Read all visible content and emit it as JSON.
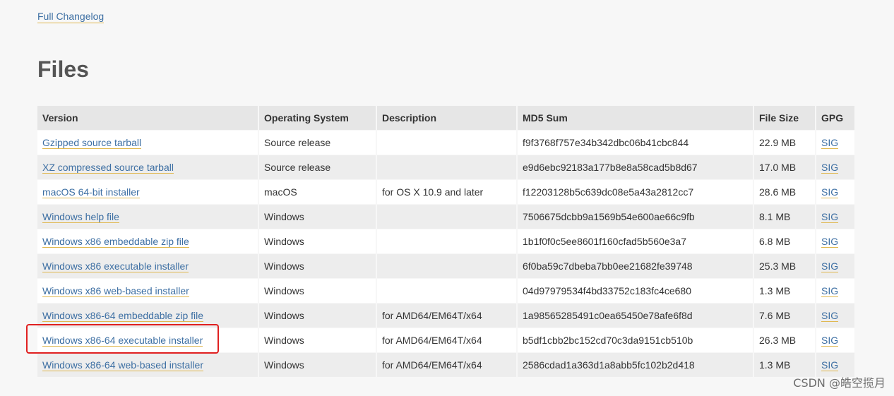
{
  "changelog_link": "Full Changelog",
  "section_title": "Files",
  "table": {
    "headers": {
      "version": "Version",
      "os": "Operating System",
      "description": "Description",
      "md5": "MD5 Sum",
      "size": "File Size",
      "gpg": "GPG"
    },
    "rows": [
      {
        "version": "Gzipped source tarball",
        "os": "Source release",
        "description": "",
        "md5": "f9f3768f757e34b342dbc06b41cbc844",
        "size": "22.9 MB",
        "gpg": "SIG"
      },
      {
        "version": "XZ compressed source tarball",
        "os": "Source release",
        "description": "",
        "md5": "e9d6ebc92183a177b8e8a58cad5b8d67",
        "size": "17.0 MB",
        "gpg": "SIG"
      },
      {
        "version": "macOS 64-bit installer",
        "os": "macOS",
        "description": "for OS X 10.9 and later",
        "md5": "f12203128b5c639dc08e5a43a2812cc7",
        "size": "28.6 MB",
        "gpg": "SIG"
      },
      {
        "version": "Windows help file",
        "os": "Windows",
        "description": "",
        "md5": "7506675dcbb9a1569b54e600ae66c9fb",
        "size": "8.1 MB",
        "gpg": "SIG"
      },
      {
        "version": "Windows x86 embeddable zip file",
        "os": "Windows",
        "description": "",
        "md5": "1b1f0f0c5ee8601f160cfad5b560e3a7",
        "size": "6.8 MB",
        "gpg": "SIG"
      },
      {
        "version": "Windows x86 executable installer",
        "os": "Windows",
        "description": "",
        "md5": "6f0ba59c7dbeba7bb0ee21682fe39748",
        "size": "25.3 MB",
        "gpg": "SIG"
      },
      {
        "version": "Windows x86 web-based installer",
        "os": "Windows",
        "description": "",
        "md5": "04d97979534f4bd33752c183fc4ce680",
        "size": "1.3 MB",
        "gpg": "SIG"
      },
      {
        "version": "Windows x86-64 embeddable zip file",
        "os": "Windows",
        "description": "for AMD64/EM64T/x64",
        "md5": "1a98565285491c0ea65450e78afe6f8d",
        "size": "7.6 MB",
        "gpg": "SIG"
      },
      {
        "version": "Windows x86-64 executable installer",
        "os": "Windows",
        "description": "for AMD64/EM64T/x64",
        "md5": "b5df1cbb2bc152cd70c3da9151cb510b",
        "size": "26.3 MB",
        "gpg": "SIG"
      },
      {
        "version": "Windows x86-64 web-based installer",
        "os": "Windows",
        "description": "for AMD64/EM64T/x64",
        "md5": "2586cdad1a363d1a8abb5fc102b2d418",
        "size": "1.3 MB",
        "gpg": "SIG"
      }
    ]
  },
  "watermark": "CSDN @皓空揽月",
  "colors": {
    "link": "#3d6fa3",
    "link_underline": "#e0b850",
    "highlight": "#e02020",
    "header_bg": "#e6e6e6",
    "page_bg": "#f7f7f7"
  }
}
